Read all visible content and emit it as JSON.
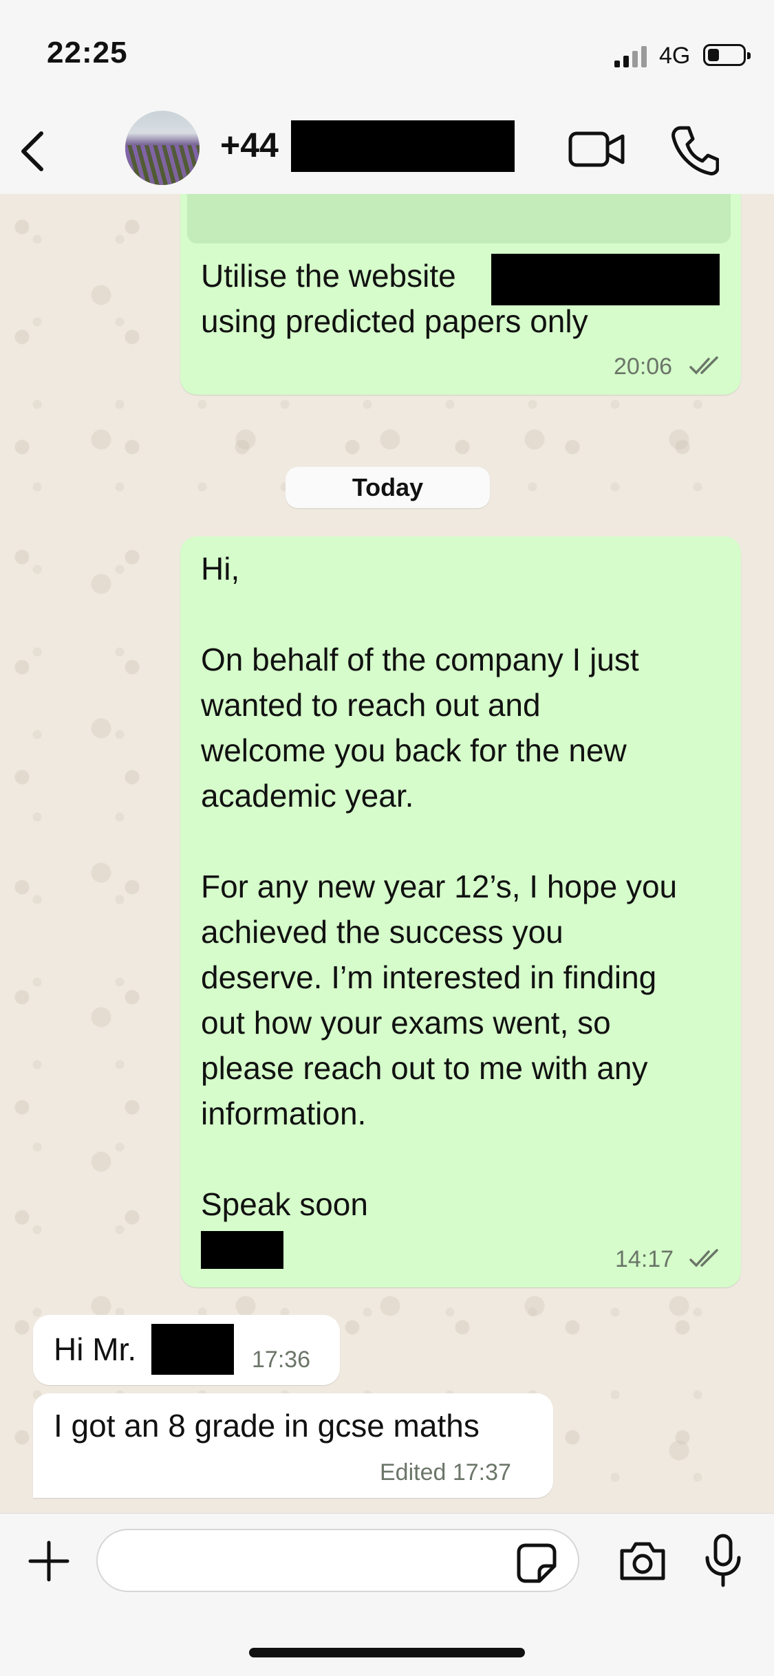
{
  "status_bar": {
    "time": "22:25",
    "network": "4G",
    "battery_icon": "battery-low-icon",
    "signal_icon": "signal-bars-icon"
  },
  "header": {
    "contact_name": "+44",
    "back_icon": "chevron-left-icon",
    "video_icon": "video-camera-icon",
    "call_icon": "phone-icon"
  },
  "messages": [
    {
      "direction": "outgoing",
      "text": "Utilise the website\nusing predicted papers only",
      "time": "20:06",
      "status_icon": "double-check-icon"
    },
    {
      "direction": "outgoing",
      "text": "Hi,\n\nOn behalf of the company I just\nwanted to reach out and\nwelcome you back for the new\nacademic year.\n\nFor any new year 12’s, I hope you\nachieved the success you\ndeserve. I’m interested in finding\nout how your exams went, so\nplease reach out to me with any\ninformation.\n\nSpeak soon",
      "time": "14:17",
      "status_icon": "double-check-icon"
    },
    {
      "direction": "incoming",
      "text": "Hi Mr.",
      "time": "17:36"
    },
    {
      "direction": "incoming",
      "text": "I got an 8 grade in gcse maths",
      "time": "Edited 17:37"
    }
  ],
  "date_divider": "Today",
  "composer": {
    "placeholder": "",
    "plus_icon": "plus-icon",
    "sticker_icon": "sticker-icon",
    "camera_icon": "camera-icon",
    "mic_icon": "microphone-icon"
  },
  "colors": {
    "outgoing_bubble": "#d5fcca",
    "incoming_bubble": "#ffffff",
    "chat_background": "#efe9e0",
    "tick_color": "#6b7568"
  }
}
